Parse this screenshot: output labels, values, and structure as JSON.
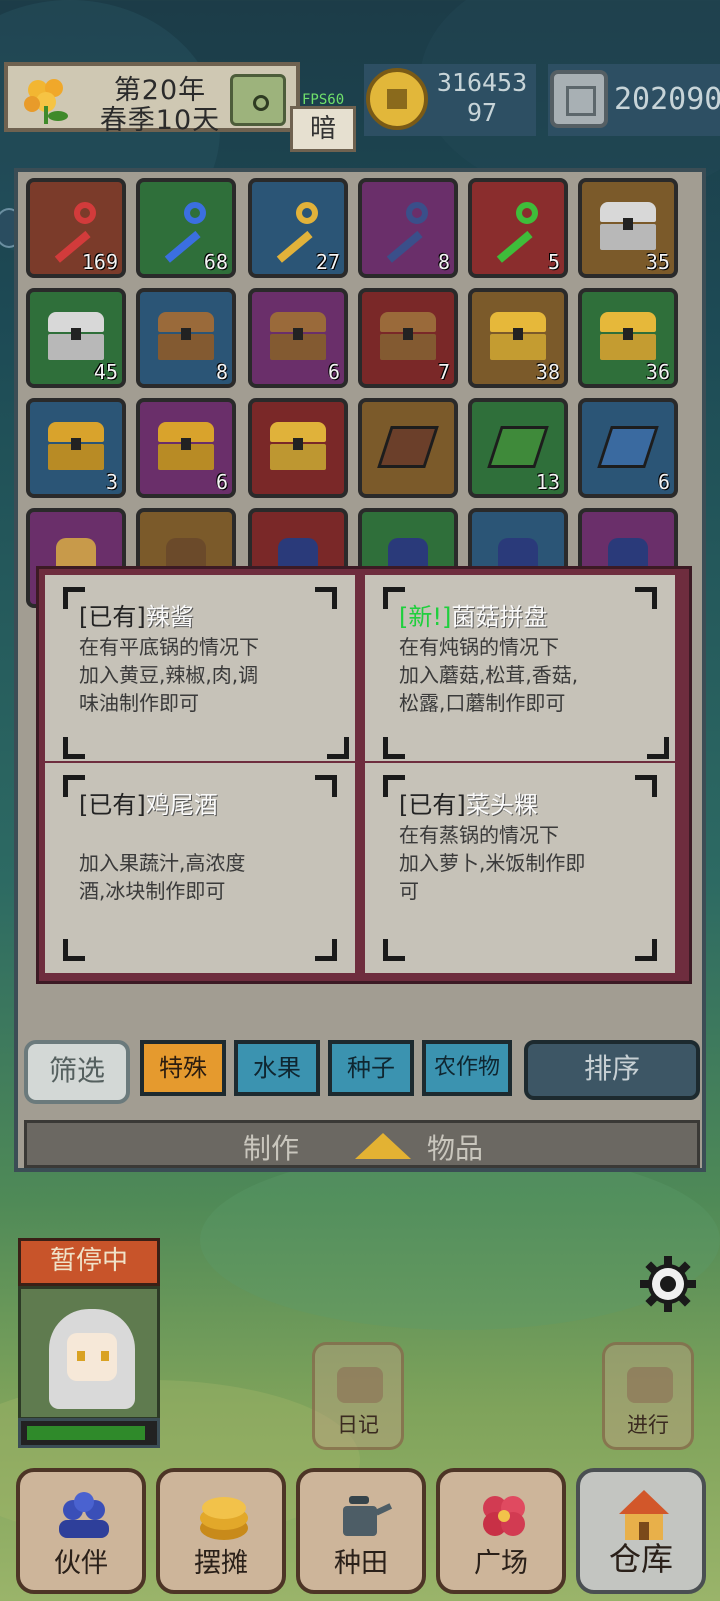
{
  "header": {
    "date_line1": "第20年",
    "date_line2": "春季10天",
    "fps": "FPS60",
    "dark_label": "暗",
    "coins_line1": "316453",
    "coins_line2": "97",
    "gems": "202090"
  },
  "inventory": {
    "rows": [
      [
        {
          "kind": "key",
          "color": "#d23b3b",
          "bg": "#7b3b2a",
          "count": "169",
          "icon": "red-key-icon"
        },
        {
          "kind": "key",
          "color": "#3b6fe0",
          "bg": "#2f6f3a",
          "count": "68",
          "icon": "blue-key-icon"
        },
        {
          "kind": "key",
          "color": "#e2b23a",
          "bg": "#2b5576",
          "count": "27",
          "icon": "gold-key-icon"
        },
        {
          "kind": "key",
          "color": "#3a4f8a",
          "bg": "#6a2f6a",
          "count": "8",
          "icon": "dark-key-icon"
        },
        {
          "kind": "key",
          "color": "#3fbd3a",
          "bg": "#8a2d2d",
          "count": "5",
          "icon": "green-key-icon"
        },
        {
          "kind": "chest",
          "color": "#d8d8d8",
          "bg": "#7b5a2a",
          "count": "35",
          "icon": "silver-chest-icon"
        }
      ],
      [
        {
          "kind": "chest",
          "color": "#d8d8d8",
          "bg": "#2f6f3a",
          "count": "45",
          "icon": "silver-chest-icon"
        },
        {
          "kind": "chest",
          "color": "#9a6a3a",
          "bg": "#2b5576",
          "count": "8",
          "icon": "wooden-chest-icon"
        },
        {
          "kind": "chest",
          "color": "#9a6a3a",
          "bg": "#6a2f6a",
          "count": "6",
          "icon": "wooden-chest-icon"
        },
        {
          "kind": "chest",
          "color": "#9a6a3a",
          "bg": "#7a2828",
          "count": "7",
          "icon": "wooden-chest-icon"
        },
        {
          "kind": "chest",
          "color": "#e6b83a",
          "bg": "#7b5a2a",
          "count": "38",
          "icon": "gold-chest-icon"
        },
        {
          "kind": "chest",
          "color": "#e6b83a",
          "bg": "#2f6f3a",
          "count": "36",
          "icon": "gold-chest-icon"
        }
      ],
      [
        {
          "kind": "chest",
          "color": "#d9a32c",
          "bg": "#2b5576",
          "count": "3",
          "icon": "treasure-chest-icon"
        },
        {
          "kind": "chest",
          "color": "#d9a32c",
          "bg": "#6a2f6a",
          "count": "6",
          "icon": "treasure-chest-icon"
        },
        {
          "kind": "chest",
          "color": "#e0b23a",
          "bg": "#7a2828",
          "count": "",
          "icon": "royal-chest-icon"
        },
        {
          "kind": "book",
          "color": "#6b3f2a",
          "bg": "#7b5a2a",
          "count": "",
          "icon": "brown-book-icon"
        },
        {
          "kind": "book",
          "color": "#3f8a3a",
          "bg": "#2f6f3a",
          "count": "13",
          "icon": "green-book-icon"
        },
        {
          "kind": "book",
          "color": "#3a6aa0",
          "bg": "#2b5576",
          "count": "6",
          "icon": "blue-book-icon"
        }
      ],
      [
        {
          "kind": "other",
          "color": "#c89a4a",
          "bg": "#6a2f6a",
          "count": "",
          "icon": "scroll-icon"
        },
        {
          "kind": "other",
          "color": "#6b4a2a",
          "bg": "#7b5a2a",
          "count": "",
          "icon": "barrel-icon"
        },
        {
          "kind": "other",
          "color": "#2a3a7a",
          "bg": "#7a2828",
          "count": "",
          "icon": "gem-pouch-icon"
        },
        {
          "kind": "other",
          "color": "#2a3a7a",
          "bg": "#2f6f3a",
          "count": "",
          "icon": "gem-pouch-icon"
        },
        {
          "kind": "other",
          "color": "#2a3a7a",
          "bg": "#2b5576",
          "count": "",
          "icon": "gem-pouch-icon"
        },
        {
          "kind": "other",
          "color": "#2a3a7a",
          "bg": "#6a2f6a",
          "count": "",
          "icon": "gem-pouch-icon"
        }
      ]
    ]
  },
  "recipes": [
    {
      "tag": "[已有]",
      "new": false,
      "name": "辣酱",
      "desc": "在有平底锅的情况下\n加入黄豆,辣椒,肉,调\n味油制作即可"
    },
    {
      "tag": "[新!]",
      "new": true,
      "name": "菌菇拼盘",
      "desc": "在有炖锅的情况下\n加入蘑菇,松茸,香菇,\n松露,口蘑制作即可"
    },
    {
      "tag": "[已有]",
      "new": false,
      "name": "鸡尾酒",
      "desc": "\n加入果蔬汁,高浓度\n酒,冰块制作即可"
    },
    {
      "tag": "[已有]",
      "new": false,
      "name": "菜头粿",
      "desc": "在有蒸锅的情况下\n加入萝卜,米饭制作即\n可"
    }
  ],
  "filters": {
    "filter_label": "筛选",
    "tabs": [
      "特殊",
      "水果",
      "种子",
      "农作物"
    ],
    "sort_label": "排序"
  },
  "craft_bar": {
    "left": "制作",
    "right": "物品"
  },
  "status": {
    "paused": "暂停中",
    "hp_fraction": 0.95
  },
  "actions": {
    "diary": "日记",
    "proceed": "进行"
  },
  "nav": [
    "伙伴",
    "摆摊",
    "种田",
    "广场",
    "仓库"
  ]
}
